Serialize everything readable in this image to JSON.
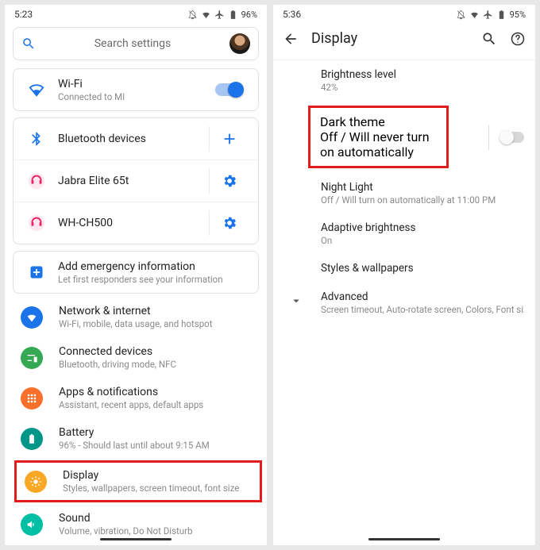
{
  "left": {
    "clock": "5:23",
    "battery": "96%",
    "search_placeholder": "Search settings",
    "wifi": {
      "title": "Wi-Fi",
      "sub": "Connected to MI"
    },
    "bluetooth": {
      "title": "Bluetooth devices"
    },
    "bt1": {
      "title": "Jabra Elite 65t"
    },
    "bt2": {
      "title": "WH-CH500"
    },
    "emergency": {
      "title": "Add emergency information",
      "sub": "Let first responders see your information"
    },
    "entries": {
      "network": {
        "title": "Network & internet",
        "sub": "Wi-Fi, mobile, data usage, and hotspot"
      },
      "connected": {
        "title": "Connected devices",
        "sub": "Bluetooth, driving mode, NFC"
      },
      "apps": {
        "title": "Apps & notifications",
        "sub": "Assistant, recent apps, default apps"
      },
      "battery": {
        "title": "Battery",
        "sub": "96% - Should last until about 9:15 AM"
      },
      "display": {
        "title": "Display",
        "sub": "Styles, wallpapers, screen timeout, font size"
      },
      "sound": {
        "title": "Sound",
        "sub": "Volume, vibration, Do Not Disturb"
      }
    }
  },
  "right": {
    "clock": "5:36",
    "battery": "95%",
    "header": "Display",
    "brightness": {
      "title": "Brightness level",
      "sub": "42%"
    },
    "dark": {
      "title": "Dark theme",
      "sub": "Off / Will never turn on automatically"
    },
    "night": {
      "title": "Night Light",
      "sub": "Off / Will turn on automatically at 11:00 PM"
    },
    "adaptive": {
      "title": "Adaptive brightness",
      "sub": "On"
    },
    "styles": {
      "title": "Styles & wallpapers"
    },
    "advanced": {
      "title": "Advanced",
      "sub": "Screen timeout, Auto-rotate screen, Colors, Font size, Di..."
    }
  }
}
